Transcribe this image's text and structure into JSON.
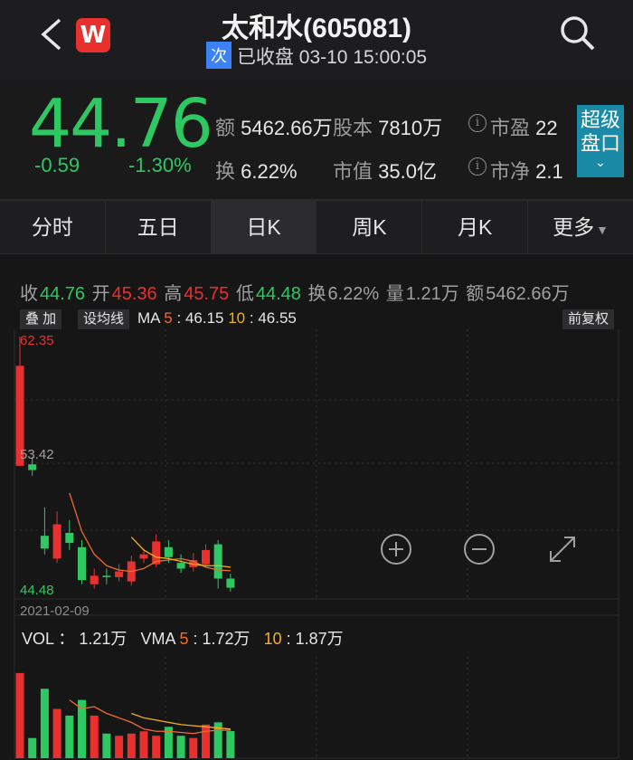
{
  "header": {
    "title": "太和水(605081)",
    "badge": "次",
    "status": "已收盘 03-10 15:00:05",
    "logo_letter": "W"
  },
  "quote": {
    "price": "44.76",
    "change": "-0.59",
    "change_pct": "-1.30%",
    "amount_label": "额",
    "amount": "5462.66万",
    "share_label": "股本",
    "share": "7810万",
    "pe_label": "市盈",
    "pe": "22",
    "turnover_label": "换",
    "turnover": "6.22%",
    "mktcap_label": "市值",
    "mktcap": "35.0亿",
    "pb_label": "市净",
    "pb": "2.1",
    "super_btn_line1": "超级",
    "super_btn_line2": "盘口"
  },
  "tabs": [
    {
      "label": "分时"
    },
    {
      "label": "五日"
    },
    {
      "label": "日K"
    },
    {
      "label": "周K"
    },
    {
      "label": "月K"
    },
    {
      "label": "更多"
    }
  ],
  "ohlc": {
    "close_label": "收",
    "close": "44.76",
    "open_label": "开",
    "open": "45.36",
    "high_label": "高",
    "high": "45.75",
    "low_label": "低",
    "low": "44.48",
    "turn_label": "换",
    "turn": "6.22%",
    "vol_label": "量",
    "vol": "1.21万",
    "amt_label": "额",
    "amt": "5462.66万"
  },
  "toolbar": {
    "overlay": "叠 加",
    "set_ma": "设均线",
    "ma_label": "MA",
    "ma5_label": "5",
    "ma5": "46.15",
    "ma10_label": "10",
    "ma10": "46.55",
    "adjust": "前复权"
  },
  "axis": {
    "high": "62.35",
    "mid": "53.42",
    "low": "44.48",
    "date": "2021-02-09"
  },
  "volume": {
    "label": "VOL",
    "value": "1.21万",
    "vma_label": "VMA",
    "vma5_label": "5",
    "vma5": "1.72万",
    "vma10_label": "10",
    "vma10": "1.87万"
  },
  "colors": {
    "up": "#e8312f",
    "down": "#2ec862",
    "ma5": "#f06a2c",
    "ma10": "#f5b01a",
    "accent": "#1b8aa7"
  },
  "chart_data": {
    "type": "candlestick",
    "ylim": [
      44.48,
      62.35
    ],
    "candles": [
      {
        "o": 53.3,
        "c": 60.3,
        "h": 62.35,
        "l": 53.3
      },
      {
        "o": 53.4,
        "c": 53.0,
        "h": 53.9,
        "l": 52.6
      },
      {
        "o": 48.4,
        "c": 47.5,
        "h": 50.4,
        "l": 47.1
      },
      {
        "o": 46.8,
        "c": 49.2,
        "h": 50.1,
        "l": 46.5
      },
      {
        "o": 48.6,
        "c": 47.9,
        "h": 49.5,
        "l": 47.4
      },
      {
        "o": 47.6,
        "c": 45.3,
        "h": 48.1,
        "l": 45.0
      },
      {
        "o": 45.0,
        "c": 45.6,
        "h": 46.1,
        "l": 44.7
      },
      {
        "o": 45.6,
        "c": 45.5,
        "h": 46.1,
        "l": 45.0
      },
      {
        "o": 45.5,
        "c": 45.9,
        "h": 46.4,
        "l": 45.2
      },
      {
        "o": 45.2,
        "c": 46.6,
        "h": 47.0,
        "l": 44.9
      },
      {
        "o": 46.8,
        "c": 47.1,
        "h": 47.5,
        "l": 46.5
      },
      {
        "o": 46.4,
        "c": 48.0,
        "h": 48.5,
        "l": 46.2
      },
      {
        "o": 47.6,
        "c": 46.9,
        "h": 48.1,
        "l": 46.5
      },
      {
        "o": 46.5,
        "c": 46.1,
        "h": 47.1,
        "l": 45.8
      },
      {
        "o": 46.2,
        "c": 46.7,
        "h": 47.2,
        "l": 45.9
      },
      {
        "o": 46.4,
        "c": 47.4,
        "h": 47.8,
        "l": 46.2
      },
      {
        "o": 47.8,
        "c": 45.4,
        "h": 48.1,
        "l": 44.7
      },
      {
        "o": 45.4,
        "c": 44.76,
        "h": 45.75,
        "l": 44.48
      }
    ],
    "ma5": [
      null,
      null,
      null,
      null,
      51.4,
      48.7,
      47.1,
      46.3,
      46.0,
      45.9,
      46.1,
      46.6,
      46.7,
      46.8,
      46.6,
      46.2,
      46.0,
      45.95
    ],
    "ma10": [
      null,
      null,
      null,
      null,
      null,
      null,
      null,
      null,
      null,
      48.3,
      47.4,
      46.9,
      46.8,
      46.6,
      46.4,
      46.3,
      46.3,
      46.2
    ],
    "volume": [
      3.8,
      0.9,
      3.1,
      2.2,
      1.9,
      2.6,
      1.9,
      1.1,
      1.0,
      1.1,
      1.2,
      1.0,
      1.4,
      1.0,
      0.9,
      1.5,
      1.6,
      1.21
    ],
    "vma5": [
      null,
      null,
      null,
      null,
      2.6,
      2.2,
      2.3,
      2.0,
      1.8,
      1.6,
      1.3,
      1.2,
      1.2,
      1.15,
      1.1,
      1.2,
      1.25,
      1.25
    ],
    "vma10": [
      null,
      null,
      null,
      null,
      null,
      null,
      null,
      null,
      null,
      2.0,
      1.8,
      1.7,
      1.6,
      1.5,
      1.45,
      1.4,
      1.35,
      1.3
    ]
  }
}
